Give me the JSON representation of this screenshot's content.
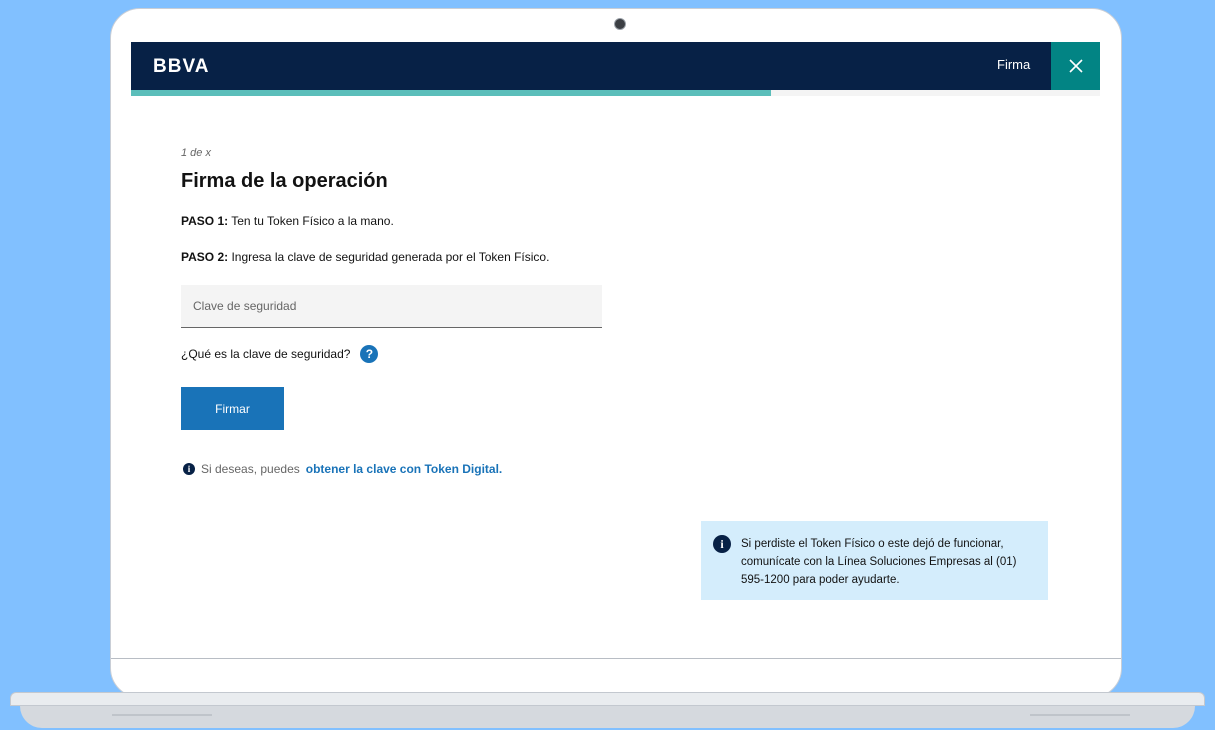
{
  "header": {
    "logo": "BBVA",
    "section_label": "Firma",
    "close_icon": "close-icon",
    "progress_percent": 66
  },
  "form": {
    "step_indicator": "1 de x",
    "title": "Firma de la operación",
    "paso1_label": "PASO 1:",
    "paso1_text": " Ten tu Token Físico a la mano.",
    "paso2_label": "PASO 2:",
    "paso2_text": " Ingresa la clave de seguridad generada por el Token Físico.",
    "input_placeholder": "Clave de seguridad",
    "input_value": "",
    "help_text": "¿Qué es la clave de seguridad?",
    "help_icon": "?",
    "submit_label": "Firmar",
    "digital_prefix": "Si deseas, puedes ",
    "digital_link": "obtener la clave con Token Digital."
  },
  "notice": {
    "icon": "i",
    "text": "Si perdiste el Token Físico o este dejó de funcionar, comunícate con la Línea Soluciones Empresas al (01) 595-1200 para poder ayudarte."
  },
  "colors": {
    "navy": "#072146",
    "teal": "#028484",
    "progress": "#5bbeba",
    "primary_blue": "#1973b8",
    "notice_bg": "#d4edfc",
    "background": "#81c0ff"
  }
}
